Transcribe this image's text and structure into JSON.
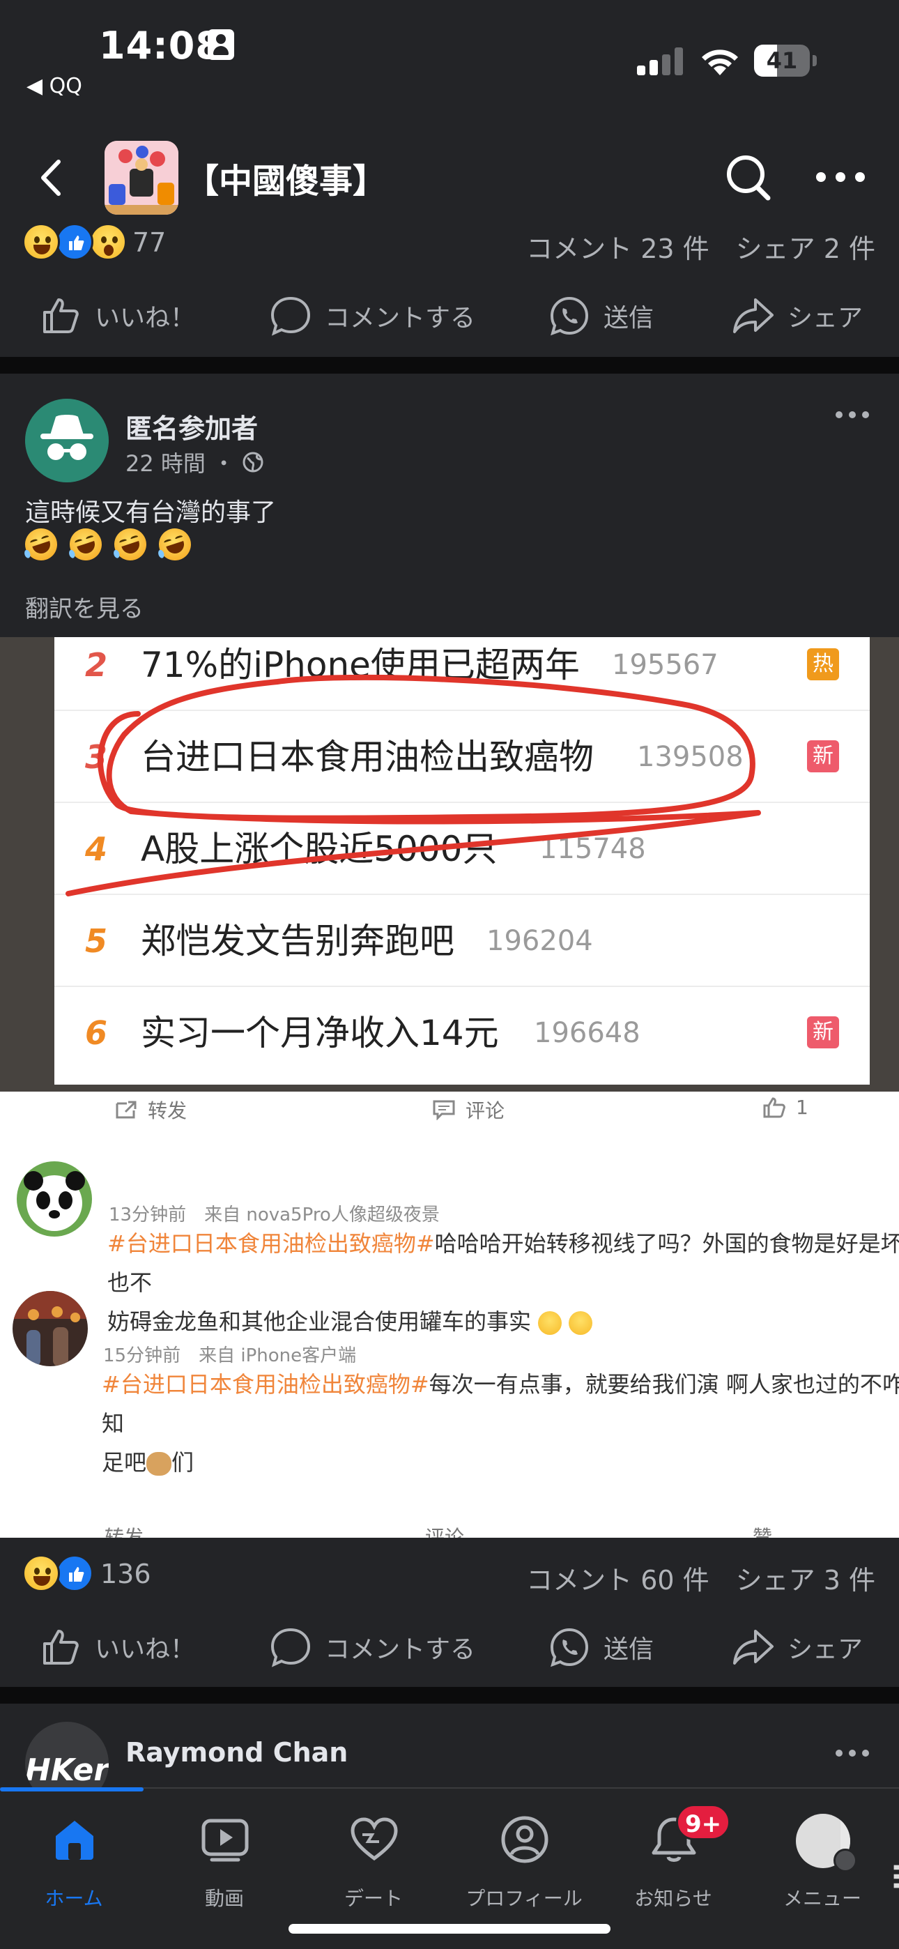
{
  "status_bar": {
    "time": "14:08",
    "back_app": "◀ QQ",
    "battery": "41",
    "battery_level": 0.41,
    "signal_bars": 2
  },
  "header": {
    "title": "【中國傻事】"
  },
  "prev_post": {
    "reaction_count": "77",
    "stats": "コメント 23 件　シェア 2 件"
  },
  "actions": {
    "like": "いいね！",
    "comment": "コメントする",
    "send": "送信",
    "share": "シェア"
  },
  "post": {
    "author": "匿名参加者",
    "time": "22 時間 ・",
    "text": "這時候又有台灣的事了",
    "emoji": "🤣🤣🤣🤣",
    "translate": "翻訳を見る",
    "reaction_count": "136",
    "stats": "コメント 60 件　シェア 3 件"
  },
  "screenshot": {
    "trending": [
      {
        "rank": "2",
        "title": "71%的iPhone使用已超两年",
        "count": "195567",
        "tag": "热"
      },
      {
        "rank": "3",
        "title": "台进口日本食用油检出致癌物",
        "count": "139508",
        "tag": "新"
      },
      {
        "rank": "4",
        "title": "A股上涨个股近5000只",
        "count": "115748",
        "tag": ""
      },
      {
        "rank": "5",
        "title": "郑恺发文告别奔跑吧",
        "count": "196204",
        "tag": ""
      },
      {
        "rank": "6",
        "title": "实习一个月净收入14元",
        "count": "196648",
        "tag": "新"
      }
    ],
    "weibo_bar": {
      "repost": "转发",
      "comment": "评论",
      "like": "1"
    },
    "comments": [
      {
        "meta": "13分钟前　来自 nova5Pro人像超级夜景",
        "hashtag": "#台进口日本食用油检出致癌物#",
        "line1": "哈哈哈开始转移视线了吗？外国的食物是好是坏，也不",
        "line2": "妨碍金龙鱼和其他企业混合使用罐车的事实"
      },
      {
        "meta": "15分钟前　来自 iPhone客户端",
        "hashtag": "#台进口日本食用油检出致癌物#",
        "line1": "每次一有点事，就要给我们演 啊人家也过的不咋地 知",
        "line2": "足吧",
        "line2_end": "们"
      }
    ],
    "weibo_bar_bottom": {
      "repost": "转发",
      "comment": "评论",
      "like": "赞"
    }
  },
  "next_post": {
    "author": "Raymond Chan",
    "avatar_text": "HKer"
  },
  "tabbar": {
    "home": "ホーム",
    "video": "動画",
    "dating": "デート",
    "profile": "プロフィール",
    "notifications": "お知らせ",
    "notifications_badge": "9+",
    "menu": "メニュー"
  },
  "colors": {
    "background": "#232427",
    "accent": "#1877f2",
    "badge": "#e41e3f",
    "hashtag": "#f0853a"
  }
}
